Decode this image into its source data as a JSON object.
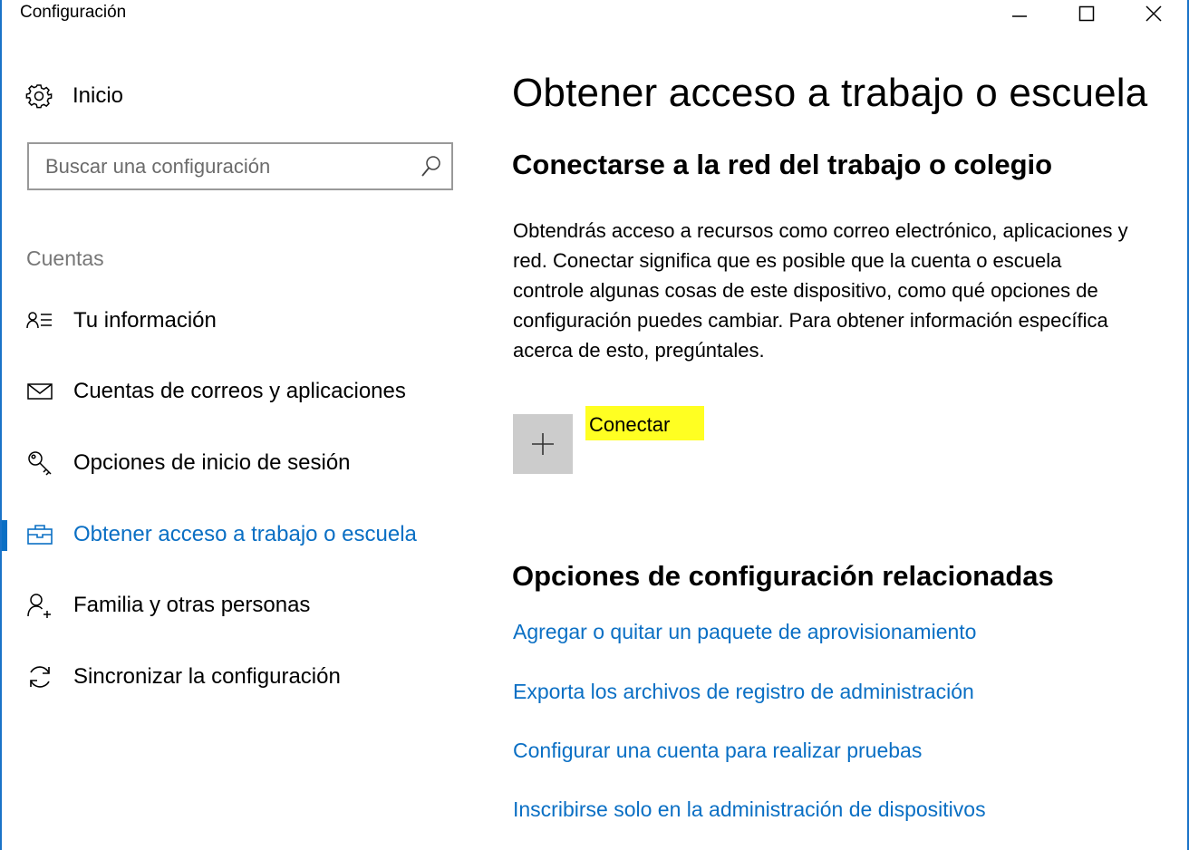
{
  "window": {
    "title": "Configuración",
    "controls": [
      "minimize-icon",
      "maximize-icon",
      "close-icon"
    ]
  },
  "sidebar": {
    "home_label": "Inicio",
    "home_icon": "gear-icon",
    "search_placeholder": "Buscar una configuración",
    "search_icon": "search-icon",
    "section_label": "Cuentas",
    "items": [
      {
        "label": "Tu información",
        "icon": "person-card-icon",
        "active": false
      },
      {
        "label": "Cuentas de correos y aplicaciones",
        "icon": "mail-icon",
        "active": false
      },
      {
        "label": "Opciones de inicio de sesión",
        "icon": "key-icon",
        "active": false
      },
      {
        "label": "Obtener acceso a trabajo o escuela",
        "icon": "briefcase-icon",
        "active": true
      },
      {
        "label": "Familia y otras personas",
        "icon": "person-add-icon",
        "active": false
      },
      {
        "label": "Sincronizar la configuración",
        "icon": "sync-icon",
        "active": false
      }
    ]
  },
  "main": {
    "title": "Obtener acceso a trabajo o escuela",
    "subtitle": "Conectarse a la red del trabajo o colegio",
    "description": "Obtendrás acceso a recursos como correo electrónico, aplicaciones y red. Conectar significa que es posible que la cuenta o escuela controle algunas cosas de este dispositivo, como qué opciones de configuración puedes cambiar. Para obtener información específica acerca de esto, pregúntales.",
    "connect_label": "Conectar",
    "connect_icon": "plus-icon",
    "related_title": "Opciones de configuración relacionadas",
    "related_links": [
      "Agregar o quitar un paquete de aprovisionamiento",
      "Exporta los archivos de registro de administración",
      "Configurar una cuenta para realizar pruebas",
      "Inscribirse solo en la administración de dispositivos"
    ]
  },
  "colors": {
    "accent": "#0a6fc4",
    "highlight": "#ffff22",
    "connect_tile": "#cccccc"
  }
}
